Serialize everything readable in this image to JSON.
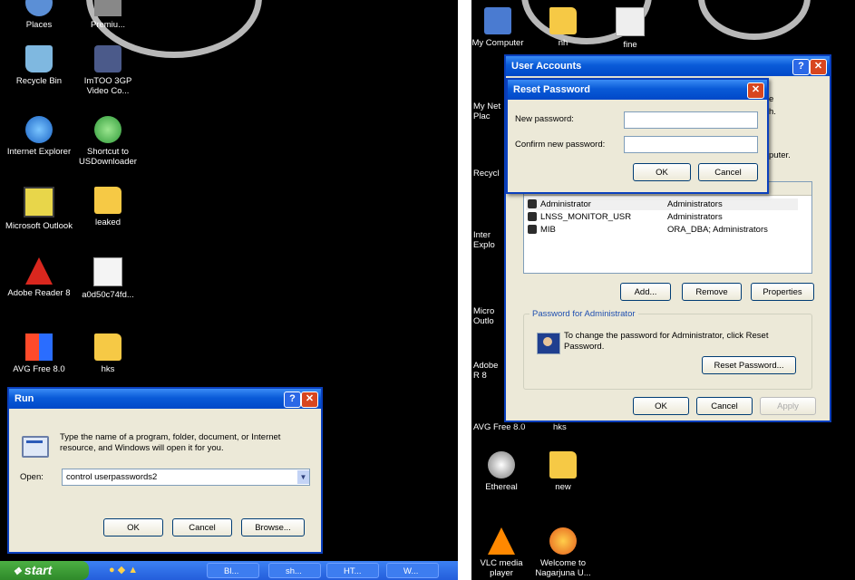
{
  "left": {
    "icons": [
      {
        "label": "Places",
        "icon": "network-places-icon"
      },
      {
        "label": "Premiu...",
        "icon": "app-icon"
      },
      {
        "label": "Recycle Bin",
        "icon": "recycle-bin-icon"
      },
      {
        "label": "ImTOO 3GP Video Co...",
        "icon": "video-converter-icon"
      },
      {
        "label": "Internet Explorer",
        "icon": "internet-explorer-icon"
      },
      {
        "label": "Shortcut to USDownloader",
        "icon": "downloader-icon"
      },
      {
        "label": "Microsoft Outlook",
        "icon": "outlook-icon"
      },
      {
        "label": "leaked",
        "icon": "folder-icon"
      },
      {
        "label": "Adobe Reader 8",
        "icon": "adobe-reader-icon"
      },
      {
        "label": "a0d50c74fd...",
        "icon": "image-file-icon"
      },
      {
        "label": "AVG Free 8.0",
        "icon": "avg-icon"
      },
      {
        "label": "hks",
        "icon": "folder-icon"
      }
    ],
    "run": {
      "title": "Run",
      "description": "Type the name of a program, folder, document, or Internet resource, and Windows will open it for you.",
      "open_label": "Open:",
      "open_value": "control userpasswords2",
      "ok": "OK",
      "cancel": "Cancel",
      "browse": "Browse..."
    },
    "taskbar": {
      "start": "start",
      "items": [
        "Bl...",
        "sh...",
        "HT...",
        "W..."
      ]
    }
  },
  "right": {
    "desktop_top": [
      {
        "label": "My Computer",
        "icon": "my-computer-icon"
      },
      {
        "label": "nh",
        "icon": "folder-icon"
      },
      {
        "label": "fine",
        "icon": "file-icon"
      }
    ],
    "desktop_side": [
      "My Net Plac",
      "Recycl",
      "Inter Explo",
      "Micro Outlo",
      "Adobe R 8",
      "AVG Free 8.0",
      "hks"
    ],
    "desktop_bottom": [
      {
        "label": "Ethereal",
        "icon": "ethereal-icon"
      },
      {
        "label": "new",
        "icon": "folder-icon"
      },
      {
        "label": "VLC media player",
        "icon": "vlc-icon"
      },
      {
        "label": "Welcome to Nagarjuna U...",
        "icon": "firefox-icon"
      }
    ],
    "user_accounts": {
      "title": "User Accounts",
      "side_text_1": "e",
      "side_text_2": "h.",
      "side_text_3": "puter.",
      "users": [
        {
          "name": "Administrator",
          "group": "Administrators"
        },
        {
          "name": "LNSS_MONITOR_USR",
          "group": "Administrators"
        },
        {
          "name": "MIB",
          "group": "ORA_DBA; Administrators"
        }
      ],
      "add": "Add...",
      "remove": "Remove",
      "properties": "Properties",
      "password_group": "Password for Administrator",
      "password_text": "To change the password for Administrator, click Reset Password.",
      "reset_password": "Reset Password...",
      "ok": "OK",
      "cancel": "Cancel",
      "apply": "Apply"
    },
    "reset_password": {
      "title": "Reset Password",
      "new_password_label": "New password:",
      "confirm_label": "Confirm new password:",
      "ok": "OK",
      "cancel": "Cancel"
    }
  }
}
